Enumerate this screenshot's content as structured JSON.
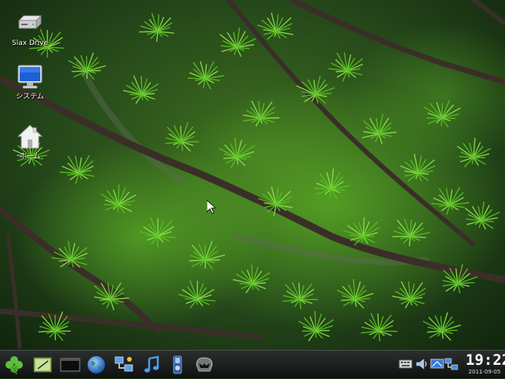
{
  "desktop": {
    "icons": [
      {
        "label": "Slax Drive",
        "icon": "hard-drive-icon"
      },
      {
        "label": "システム",
        "icon": "monitor-icon"
      },
      {
        "label": "ホーム",
        "icon": "home-icon"
      }
    ],
    "wallpaper": "larch-branches",
    "colors": {
      "leaf": "#57c21e",
      "bark": "#3a2f28",
      "bg": "#1d3a12"
    }
  },
  "taskbar": {
    "launchers": [
      {
        "icon": "clover-menu-icon"
      },
      {
        "icon": "notepad-icon"
      },
      {
        "icon": "terminal-icon"
      },
      {
        "icon": "globe-browser-icon"
      },
      {
        "icon": "network-icon"
      },
      {
        "icon": "music-note-icon"
      },
      {
        "icon": "media-player-icon"
      },
      {
        "icon": "helmet-icon"
      }
    ],
    "tray": [
      {
        "icon": "keyboard-icon"
      },
      {
        "icon": "volume-icon"
      },
      {
        "icon": "display-icon"
      },
      {
        "icon": "network-status-icon"
      }
    ],
    "clock": {
      "time": "19:22",
      "date": "2011-09-05"
    }
  }
}
